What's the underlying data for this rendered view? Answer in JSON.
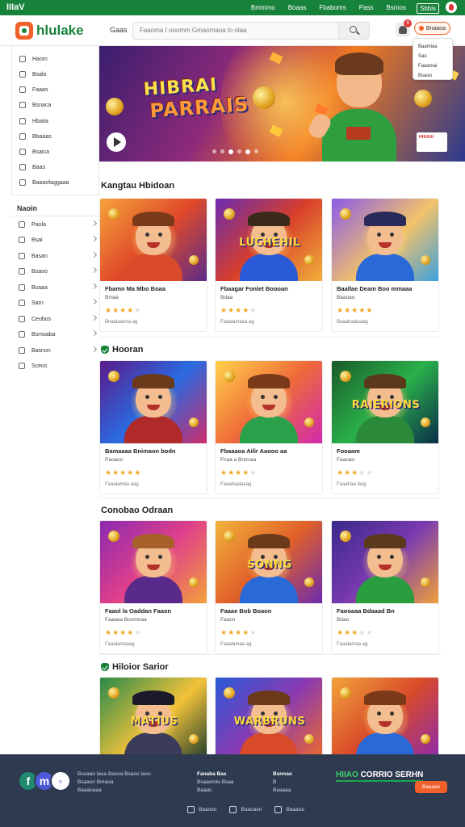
{
  "topbar": {
    "brand": "IIIaV",
    "links": [
      "Bmmmo",
      "Boaas",
      "Fbaboms",
      "Pass",
      "Bsmos",
      "Sbbis"
    ]
  },
  "header": {
    "logo_text": "hlulake",
    "nav_label": "Gaas",
    "search_placeholder": "Faaoma I ooomm  Gmaomaoa lo olaa",
    "bell_count": "9",
    "login_label": "Bnaaoa"
  },
  "dropdown": {
    "items": [
      "Baamiaa",
      "Sao",
      "Faaamai",
      "Bsaoo"
    ]
  },
  "sidebar": {
    "items": [
      "Haom",
      "Bsalo",
      "Faaas",
      "Bsnaca",
      "Hbaiia",
      "Bbaaas",
      "Bsaica",
      "Baas",
      "Baaaofaggaaa"
    ],
    "section_title": "Naoin",
    "categories": [
      "Paola",
      "Bsai",
      "Basan",
      "Bsaoo",
      "Bsaaa",
      "Sarn",
      "Ceobos",
      "Bsmoaba",
      "Basnon",
      "Sceos"
    ]
  },
  "hero": {
    "title_line1": "HIBRAI",
    "title_line2": "PARRAIS",
    "tag": "HHUUU"
  },
  "sections": [
    {
      "title": "Kangtau Hbidoan",
      "icon": false,
      "cards": [
        {
          "title": "Fbamn Ma Mbo Boaa",
          "sub": "Bmaa",
          "stars": 4,
          "meta": "Bnaalaanoa ag",
          "banner": ""
        },
        {
          "title": "Fbaagar Fonlet Boooan",
          "sub": "Bdaa",
          "stars": 4,
          "meta": "Faaalamaaa ag",
          "banner": "LUCHEHIL"
        },
        {
          "title": "Baallae Deam Boo mmaaa",
          "sub": "Baaoao",
          "stars": 5,
          "meta": "Baaahaalaaag",
          "banner": ""
        }
      ]
    },
    {
      "title": "Hooran",
      "icon": true,
      "cards": [
        {
          "title": "Bamaaaa Bnimaon bodn",
          "sub": "Paoaoo",
          "stars": 5,
          "meta": "Faaalamaa aag",
          "banner": ""
        },
        {
          "title": "Fbaaaoa Ailir Aaooo aa",
          "sub": "Fnaa a Bnimaa",
          "stars": 4,
          "meta": "Faaahaalaaag",
          "banner": ""
        },
        {
          "title": "Fooaam",
          "sub": "Faaoao",
          "stars": 3,
          "meta": "Faaahaa laag",
          "banner": "RAIERIONS"
        }
      ]
    },
    {
      "title": "Conobao Odraan",
      "icon": false,
      "cards": [
        {
          "title": "Faaol la Oaddan Faaon",
          "sub": "Faaaea Boomnaa",
          "stars": 4,
          "meta": "Faaalamaaag",
          "banner": ""
        },
        {
          "title": "Faaae Bob Boaon",
          "sub": "Faaon",
          "stars": 4,
          "meta": "Faaalamaa ag",
          "banner": "SONNG"
        },
        {
          "title": "Faooaaa Bdaaad Bn",
          "sub": "Bdao",
          "stars": 3,
          "meta": "Faaalamaa ag",
          "banner": ""
        }
      ]
    },
    {
      "title": "Hiloior Sarior",
      "icon": true,
      "cards": [
        {
          "title": "",
          "sub": "",
          "stars": 0,
          "meta": "",
          "banner": "MATIUS"
        },
        {
          "title": "",
          "sub": "",
          "stars": 0,
          "meta": "",
          "banner": "WARBRUNS"
        },
        {
          "title": "",
          "sub": "",
          "stars": 0,
          "meta": "",
          "banner": ""
        }
      ]
    }
  ],
  "footer": {
    "about": [
      "Bsoaao laoa Basoa Bsaoo laoo",
      "Bsaaon Bmaoa",
      "Baaaoaaa"
    ],
    "col1_title": "Fanaba Bas",
    "col1": [
      "Bsaaomlo Bsaa",
      "Baaas"
    ],
    "col2_title": "Bsnnao",
    "col2": [
      "B",
      "Baaaaa"
    ],
    "promo_green": "HIIAO",
    "promo_white": "CORRIO SERHN",
    "cta": "Baaaas",
    "bottom_links": [
      "Baaooo",
      "Baaoaon",
      "Baaaoa"
    ]
  },
  "colors": {
    "brand_green": "#17823a",
    "accent_orange": "#f0602a",
    "footer_bg": "#2d3a4f",
    "star": "#f2a622"
  },
  "icons": [
    "search-icon",
    "bell-icon",
    "play-icon",
    "shield-icon",
    "chevron-right-icon",
    "facebook-icon"
  ]
}
